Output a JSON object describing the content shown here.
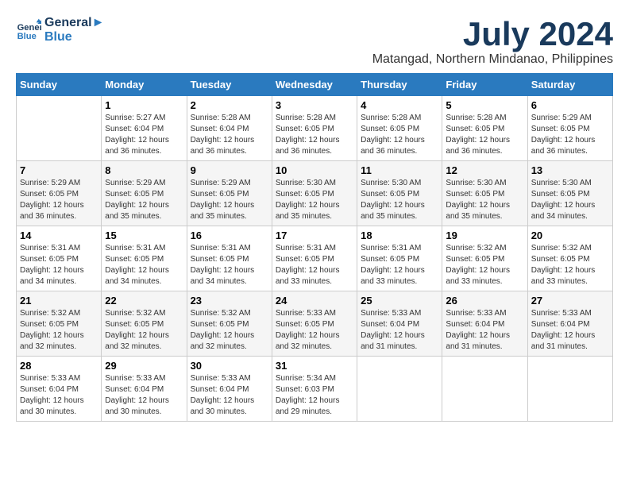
{
  "logo": {
    "line1": "General",
    "line2": "Blue"
  },
  "title": "July 2024",
  "subtitle": "Matangad, Northern Mindanao, Philippines",
  "days_header": [
    "Sunday",
    "Monday",
    "Tuesday",
    "Wednesday",
    "Thursday",
    "Friday",
    "Saturday"
  ],
  "weeks": [
    [
      {
        "day": "",
        "sunrise": "",
        "sunset": "",
        "daylight": ""
      },
      {
        "day": "1",
        "sunrise": "Sunrise: 5:27 AM",
        "sunset": "Sunset: 6:04 PM",
        "daylight": "Daylight: 12 hours and 36 minutes."
      },
      {
        "day": "2",
        "sunrise": "Sunrise: 5:28 AM",
        "sunset": "Sunset: 6:04 PM",
        "daylight": "Daylight: 12 hours and 36 minutes."
      },
      {
        "day": "3",
        "sunrise": "Sunrise: 5:28 AM",
        "sunset": "Sunset: 6:05 PM",
        "daylight": "Daylight: 12 hours and 36 minutes."
      },
      {
        "day": "4",
        "sunrise": "Sunrise: 5:28 AM",
        "sunset": "Sunset: 6:05 PM",
        "daylight": "Daylight: 12 hours and 36 minutes."
      },
      {
        "day": "5",
        "sunrise": "Sunrise: 5:28 AM",
        "sunset": "Sunset: 6:05 PM",
        "daylight": "Daylight: 12 hours and 36 minutes."
      },
      {
        "day": "6",
        "sunrise": "Sunrise: 5:29 AM",
        "sunset": "Sunset: 6:05 PM",
        "daylight": "Daylight: 12 hours and 36 minutes."
      }
    ],
    [
      {
        "day": "7",
        "sunrise": "Sunrise: 5:29 AM",
        "sunset": "Sunset: 6:05 PM",
        "daylight": "Daylight: 12 hours and 36 minutes."
      },
      {
        "day": "8",
        "sunrise": "Sunrise: 5:29 AM",
        "sunset": "Sunset: 6:05 PM",
        "daylight": "Daylight: 12 hours and 35 minutes."
      },
      {
        "day": "9",
        "sunrise": "Sunrise: 5:29 AM",
        "sunset": "Sunset: 6:05 PM",
        "daylight": "Daylight: 12 hours and 35 minutes."
      },
      {
        "day": "10",
        "sunrise": "Sunrise: 5:30 AM",
        "sunset": "Sunset: 6:05 PM",
        "daylight": "Daylight: 12 hours and 35 minutes."
      },
      {
        "day": "11",
        "sunrise": "Sunrise: 5:30 AM",
        "sunset": "Sunset: 6:05 PM",
        "daylight": "Daylight: 12 hours and 35 minutes."
      },
      {
        "day": "12",
        "sunrise": "Sunrise: 5:30 AM",
        "sunset": "Sunset: 6:05 PM",
        "daylight": "Daylight: 12 hours and 35 minutes."
      },
      {
        "day": "13",
        "sunrise": "Sunrise: 5:30 AM",
        "sunset": "Sunset: 6:05 PM",
        "daylight": "Daylight: 12 hours and 34 minutes."
      }
    ],
    [
      {
        "day": "14",
        "sunrise": "Sunrise: 5:31 AM",
        "sunset": "Sunset: 6:05 PM",
        "daylight": "Daylight: 12 hours and 34 minutes."
      },
      {
        "day": "15",
        "sunrise": "Sunrise: 5:31 AM",
        "sunset": "Sunset: 6:05 PM",
        "daylight": "Daylight: 12 hours and 34 minutes."
      },
      {
        "day": "16",
        "sunrise": "Sunrise: 5:31 AM",
        "sunset": "Sunset: 6:05 PM",
        "daylight": "Daylight: 12 hours and 34 minutes."
      },
      {
        "day": "17",
        "sunrise": "Sunrise: 5:31 AM",
        "sunset": "Sunset: 6:05 PM",
        "daylight": "Daylight: 12 hours and 33 minutes."
      },
      {
        "day": "18",
        "sunrise": "Sunrise: 5:31 AM",
        "sunset": "Sunset: 6:05 PM",
        "daylight": "Daylight: 12 hours and 33 minutes."
      },
      {
        "day": "19",
        "sunrise": "Sunrise: 5:32 AM",
        "sunset": "Sunset: 6:05 PM",
        "daylight": "Daylight: 12 hours and 33 minutes."
      },
      {
        "day": "20",
        "sunrise": "Sunrise: 5:32 AM",
        "sunset": "Sunset: 6:05 PM",
        "daylight": "Daylight: 12 hours and 33 minutes."
      }
    ],
    [
      {
        "day": "21",
        "sunrise": "Sunrise: 5:32 AM",
        "sunset": "Sunset: 6:05 PM",
        "daylight": "Daylight: 12 hours and 32 minutes."
      },
      {
        "day": "22",
        "sunrise": "Sunrise: 5:32 AM",
        "sunset": "Sunset: 6:05 PM",
        "daylight": "Daylight: 12 hours and 32 minutes."
      },
      {
        "day": "23",
        "sunrise": "Sunrise: 5:32 AM",
        "sunset": "Sunset: 6:05 PM",
        "daylight": "Daylight: 12 hours and 32 minutes."
      },
      {
        "day": "24",
        "sunrise": "Sunrise: 5:33 AM",
        "sunset": "Sunset: 6:05 PM",
        "daylight": "Daylight: 12 hours and 32 minutes."
      },
      {
        "day": "25",
        "sunrise": "Sunrise: 5:33 AM",
        "sunset": "Sunset: 6:04 PM",
        "daylight": "Daylight: 12 hours and 31 minutes."
      },
      {
        "day": "26",
        "sunrise": "Sunrise: 5:33 AM",
        "sunset": "Sunset: 6:04 PM",
        "daylight": "Daylight: 12 hours and 31 minutes."
      },
      {
        "day": "27",
        "sunrise": "Sunrise: 5:33 AM",
        "sunset": "Sunset: 6:04 PM",
        "daylight": "Daylight: 12 hours and 31 minutes."
      }
    ],
    [
      {
        "day": "28",
        "sunrise": "Sunrise: 5:33 AM",
        "sunset": "Sunset: 6:04 PM",
        "daylight": "Daylight: 12 hours and 30 minutes."
      },
      {
        "day": "29",
        "sunrise": "Sunrise: 5:33 AM",
        "sunset": "Sunset: 6:04 PM",
        "daylight": "Daylight: 12 hours and 30 minutes."
      },
      {
        "day": "30",
        "sunrise": "Sunrise: 5:33 AM",
        "sunset": "Sunset: 6:04 PM",
        "daylight": "Daylight: 12 hours and 30 minutes."
      },
      {
        "day": "31",
        "sunrise": "Sunrise: 5:34 AM",
        "sunset": "Sunset: 6:03 PM",
        "daylight": "Daylight: 12 hours and 29 minutes."
      },
      {
        "day": "",
        "sunrise": "",
        "sunset": "",
        "daylight": ""
      },
      {
        "day": "",
        "sunrise": "",
        "sunset": "",
        "daylight": ""
      },
      {
        "day": "",
        "sunrise": "",
        "sunset": "",
        "daylight": ""
      }
    ]
  ]
}
